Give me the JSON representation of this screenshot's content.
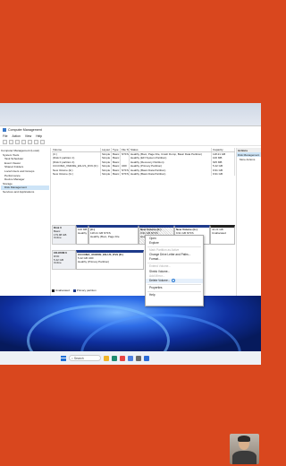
{
  "window": {
    "title": "Computer Management"
  },
  "menu": [
    "File",
    "Action",
    "View",
    "Help"
  ],
  "tree": [
    "Computer Management (Local)",
    "System Tools",
    "Task Scheduler",
    "Event Viewer",
    "Shared Folders",
    "Local Users and Groups",
    "Performance",
    "Device Manager",
    "Storage",
    "Disk Management",
    "Services and Applications"
  ],
  "volume_table": {
    "headers": [
      "Volume",
      "Layout",
      "Type",
      "File System",
      "Status",
      "Capacity"
    ],
    "rows": [
      [
        "(C:)",
        "Simple",
        "Basic",
        "NTFS",
        "Healthy (Boot, Page File, Crash Dump, Basic Data Partition)",
        "118.21 GB"
      ],
      [
        "(Disk 0 partition 1)",
        "Simple",
        "Basic",
        "",
        "Healthy (EFI System Partition)",
        "100 MB"
      ],
      [
        "(Disk 0 partition 4)",
        "Simple",
        "Basic",
        "",
        "Healthy (Recovery Partition)",
        "625 MB"
      ],
      [
        "CCCOMA_X64FRE_EN-US_DV9 (D:)",
        "Simple",
        "Basic",
        "UDF",
        "Healthy (Primary Partition)",
        "5.42 GB"
      ],
      [
        "New Volume (E:)",
        "Simple",
        "Basic",
        "NTFS",
        "Healthy (Basic Data Partition)",
        "9.91 GB"
      ],
      [
        "New Volume (G:)",
        "Simple",
        "Basic",
        "NTFS",
        "Healthy (Basic Data Partition)",
        "9.91 GB"
      ]
    ]
  },
  "actions": {
    "header": "Actions",
    "selected": "Disk Management",
    "more": "More Actions"
  },
  "disks": {
    "disk0": {
      "label": "Disk 0",
      "type": "Basic",
      "size": "179.98 GB",
      "status": "Online",
      "partitions": [
        {
          "name": "",
          "size": "100 MB",
          "status": "Healthy (EFI"
        },
        {
          "name": "(C:)",
          "size": "118.21 GB NTFS",
          "status": "Healthy (Boot, Page File"
        },
        {
          "name": "New Volume (E:)",
          "size": "9.91 GB NTFS",
          "status": "Healthy (Basic"
        },
        {
          "name": "New Volume (G:)",
          "size": "9.91 GB NTFS",
          "status": "Healthy (Basic"
        },
        {
          "name": "",
          "size": "41.21 GB",
          "status": "Unallocated"
        }
      ]
    },
    "cdrom": {
      "label": "CD-ROM 0",
      "type": "DVD",
      "size": "5.42 GB",
      "status": "Online",
      "partition": {
        "name": "CCCOMA_X64FRE_EN-US_DV9 (D:)",
        "size": "5.42 GB UDF",
        "status": "Healthy (Primary Partition)"
      }
    }
  },
  "legend": {
    "unallocated": "Unallocated",
    "primary": "Primary partition"
  },
  "context_menu": {
    "items": [
      {
        "label": "Open",
        "disabled": false
      },
      {
        "label": "Explore",
        "disabled": false
      },
      {
        "sep": true
      },
      {
        "label": "Mark Partition as Active",
        "disabled": true
      },
      {
        "label": "Change Drive Letter and Paths...",
        "disabled": false
      },
      {
        "label": "Format...",
        "disabled": false
      },
      {
        "sep": true
      },
      {
        "label": "Extend Volume...",
        "disabled": true
      },
      {
        "label": "Shrink Volume...",
        "disabled": false
      },
      {
        "label": "Add Mirror...",
        "disabled": true
      },
      {
        "label": "Delete Volume...",
        "disabled": false,
        "highlight": true
      },
      {
        "sep": true
      },
      {
        "label": "Properties",
        "disabled": false
      },
      {
        "sep": true
      },
      {
        "label": "Help",
        "disabled": false
      }
    ]
  },
  "taskbar": {
    "search_placeholder": "Search"
  },
  "colors": {
    "background": "#d9471e",
    "accent": "#1e3a8a",
    "selection": "#cde4f7"
  }
}
